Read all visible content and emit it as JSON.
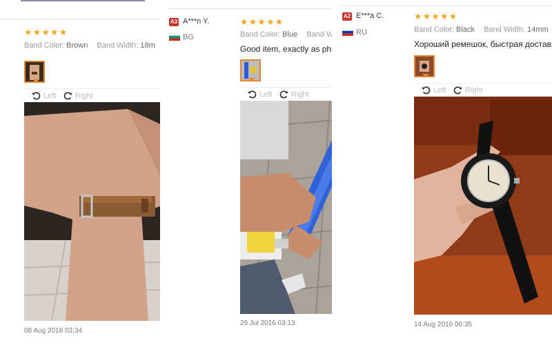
{
  "reviews": [
    {
      "stars": "★★★★★",
      "band_color_label": "Band Color:",
      "band_color": "Brown",
      "band_width_label": "Band Width:",
      "band_width": "18m",
      "date": "08 Aug 2016 03:34"
    },
    {
      "badge": "A3",
      "user": "A***n Y.",
      "country": "BG",
      "stars": "★★★★★",
      "band_color_label": "Band Color:",
      "band_color": "Blue",
      "band_width_label": "Band Wi",
      "text": "Good item, exactly as photo",
      "date": "29 Jul 2016 03:13"
    },
    {
      "badge": "A2",
      "user": "E***a C.",
      "country": "RU",
      "stars": "★★★★★",
      "band_color_label": "Band Color:",
      "band_color": "Black",
      "band_width_label": "Band Width:",
      "band_width": "14mm",
      "text": "Хороший ремешок, быстрая доставка",
      "date": "14 Aug 2016 06:35"
    }
  ],
  "rotate": {
    "left": "Left",
    "right": "Right",
    "close": "×"
  },
  "colors": {
    "star": "#f5a623",
    "thumb_border": "#e8862e",
    "badge": "#c9302c"
  }
}
